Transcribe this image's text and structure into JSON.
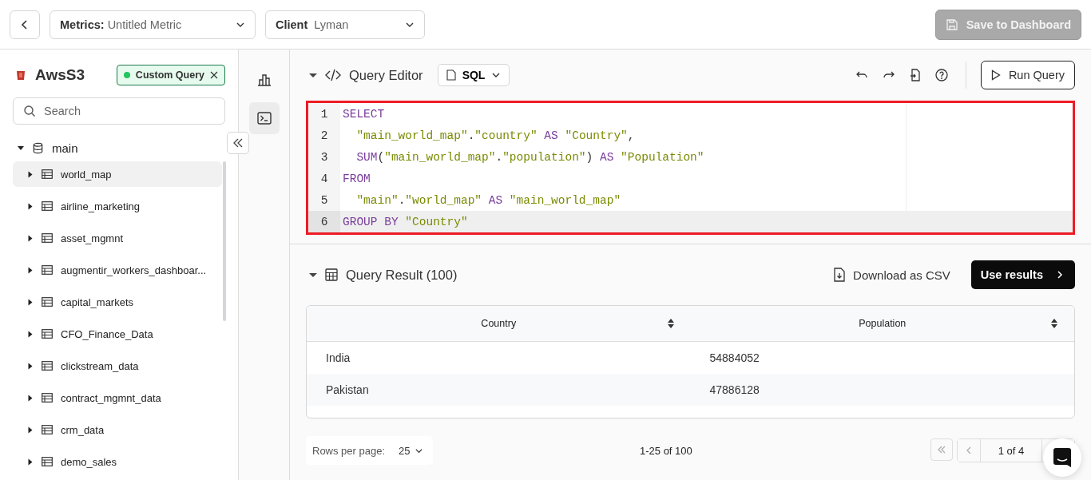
{
  "header": {
    "metric": {
      "label": "Metrics:",
      "value": "Untitled Metric"
    },
    "client": {
      "label": "Client",
      "value": "Lyman"
    },
    "save_button": {
      "label": "Save to Dashboard",
      "disabled": true
    }
  },
  "sidebar": {
    "source": "AwsS3",
    "badge": {
      "label": "Custom Query",
      "color": "#22c55e"
    },
    "search": {
      "placeholder": "Search"
    },
    "tree": [
      {
        "label": "main",
        "expanded": true,
        "selected": false,
        "children": [
          {
            "label": "world_map",
            "expanded": false,
            "selected": true
          },
          {
            "label": "airline_marketing",
            "expanded": false,
            "selected": false
          },
          {
            "label": "asset_mgmnt",
            "expanded": false,
            "selected": false
          },
          {
            "label": "augmentir_workers_dashboar...",
            "expanded": false,
            "selected": false
          },
          {
            "label": "capital_markets",
            "expanded": false,
            "selected": false
          },
          {
            "label": "CFO_Finance_Data",
            "expanded": false,
            "selected": false
          },
          {
            "label": "clickstream_data",
            "expanded": false,
            "selected": false
          },
          {
            "label": "contract_mgmnt_data",
            "expanded": false,
            "selected": false
          },
          {
            "label": "crm_data",
            "expanded": false,
            "selected": false
          },
          {
            "label": "demo_sales",
            "expanded": false,
            "selected": false
          }
        ]
      }
    ]
  },
  "rail": [
    {
      "kind": "chart",
      "selected": false
    },
    {
      "kind": "terminal",
      "selected": true
    }
  ],
  "editor": {
    "title": "Query Editor",
    "expanded": true,
    "language": "SQL",
    "run_button": "Run Query",
    "lines": [
      {
        "number": "1",
        "active": false,
        "tokens": [
          {
            "kind": "kw",
            "text": "SELECT"
          }
        ]
      },
      {
        "number": "2",
        "active": false,
        "tokens": [
          {
            "kind": "str",
            "text": "  \"main_world_map\""
          },
          {
            "kind": "plain",
            "text": "."
          },
          {
            "kind": "str",
            "text": "\"country\""
          },
          {
            "kind": "kw",
            "text": " AS"
          },
          {
            "kind": "str",
            "text": " \"Country\""
          },
          {
            "kind": "plain",
            "text": ","
          }
        ]
      },
      {
        "number": "3",
        "active": false,
        "tokens": [
          {
            "kind": "kw",
            "text": "  SUM"
          },
          {
            "kind": "plain",
            "text": "("
          },
          {
            "kind": "str",
            "text": "\"main_world_map\""
          },
          {
            "kind": "plain",
            "text": "."
          },
          {
            "kind": "str",
            "text": "\"population\""
          },
          {
            "kind": "plain",
            "text": ") "
          },
          {
            "kind": "kw",
            "text": "AS"
          },
          {
            "kind": "str",
            "text": " \"Population\""
          }
        ]
      },
      {
        "number": "4",
        "active": false,
        "tokens": [
          {
            "kind": "kw",
            "text": "FROM"
          }
        ]
      },
      {
        "number": "5",
        "active": false,
        "tokens": [
          {
            "kind": "str",
            "text": "  \"main\""
          },
          {
            "kind": "plain",
            "text": "."
          },
          {
            "kind": "str",
            "text": "\"world_map\""
          },
          {
            "kind": "kw",
            "text": " AS"
          },
          {
            "kind": "str",
            "text": " \"main_world_map\""
          }
        ]
      },
      {
        "number": "6",
        "active": true,
        "tokens": [
          {
            "kind": "kw",
            "text": "GROUP BY"
          },
          {
            "kind": "str",
            "text": " \"Country\""
          }
        ]
      }
    ]
  },
  "result": {
    "title": "Query Result (100)",
    "expanded": true,
    "download": "Download as CSV",
    "use_button": "Use results",
    "table": {
      "columns": [
        "Country",
        "Population"
      ],
      "rows": [
        [
          "India",
          "54884052"
        ],
        [
          "Pakistan",
          "47886128"
        ]
      ]
    },
    "rows_per_page": {
      "label": "Rows per page:",
      "value": "25"
    },
    "range": "1-25 of 100",
    "page": "1 of 4"
  }
}
